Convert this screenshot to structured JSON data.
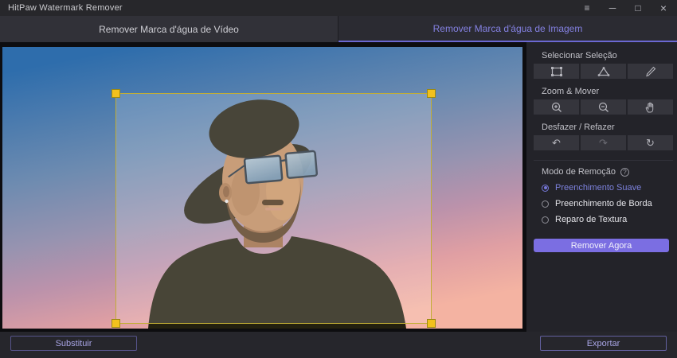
{
  "window": {
    "title": "HitPaw Watermark Remover",
    "controls": [
      {
        "name": "menu-icon",
        "glyph": "≡"
      },
      {
        "name": "minimize-icon",
        "glyph": "─"
      },
      {
        "name": "maximize-icon",
        "glyph": "□"
      },
      {
        "name": "close-icon",
        "glyph": "×"
      }
    ]
  },
  "tabs": [
    {
      "label": "Remover Marca d'água de Vídeo",
      "active": false
    },
    {
      "label": "Remover Marca d'água de Imagem",
      "active": true
    }
  ],
  "canvas": {
    "image_description": "man with wide-brim black hat and sunglasses on blue-to-pink gradient background",
    "selection": {
      "visible": true,
      "handle_color": "#f2c11d"
    }
  },
  "sidebar": {
    "sections": [
      {
        "title": "Selecionar Seleção",
        "tools": [
          {
            "icon": "rectangle-select-icon"
          },
          {
            "icon": "polygon-select-icon"
          },
          {
            "icon": "brush-select-icon"
          }
        ]
      },
      {
        "title": "Zoom & Mover",
        "tools": [
          {
            "icon": "zoom-in-icon"
          },
          {
            "icon": "zoom-out-icon"
          },
          {
            "icon": "pan-hand-icon"
          }
        ]
      },
      {
        "title": "Desfazer / Refazer",
        "tools": [
          {
            "icon": "undo-icon",
            "glyph": "↶"
          },
          {
            "icon": "redo-icon",
            "glyph": "↷"
          },
          {
            "icon": "reset-icon",
            "glyph": "↻"
          }
        ]
      }
    ],
    "removal_mode": {
      "title": "Modo de Remoção",
      "help_glyph": "?",
      "options": [
        {
          "label": "Preenchimento Suave",
          "selected": true
        },
        {
          "label": "Preenchimento de Borda",
          "selected": false
        },
        {
          "label": "Reparo de Textura",
          "selected": false
        }
      ]
    },
    "remove_button_label": "Remover Agora"
  },
  "footer": {
    "replace_button_label": "Substituir",
    "export_button_label": "Exportar"
  },
  "colors": {
    "accent_purple": "#7b6ee2",
    "active_tab_text": "#8481e2",
    "selection_yellow": "#f2c11d",
    "selected_option": "#7577d8"
  }
}
